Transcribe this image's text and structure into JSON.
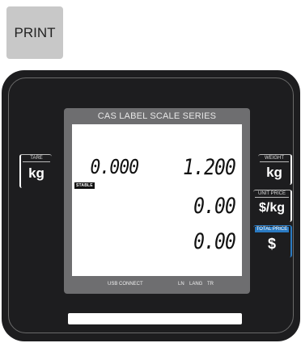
{
  "print_button": {
    "label": "PRINT"
  },
  "display": {
    "title": "CAS LABEL SCALE SERIES",
    "tare_value": "0.000",
    "weight_value": "1.200",
    "unit_price_value": "0.00",
    "total_price_value": "0.00",
    "stable_badge": "STABLE",
    "status": {
      "usb": "USB CONNECT",
      "ln": "LN",
      "lang": "LANG",
      "tr": "TR"
    }
  },
  "left_panel": {
    "label": "TARE",
    "unit": "kg"
  },
  "right_panels": [
    {
      "label": "WEIGHT",
      "unit": "kg"
    },
    {
      "label": "UNIT PRICE",
      "unit": "$/kg"
    },
    {
      "label": "TOTAL PRICE",
      "unit": "$"
    }
  ],
  "colors": {
    "scale_body": "#1d1d1f",
    "display_frame": "#6e6e70",
    "total_price_accent": "#2a7ac2",
    "print_button": "#c8c8c8"
  }
}
